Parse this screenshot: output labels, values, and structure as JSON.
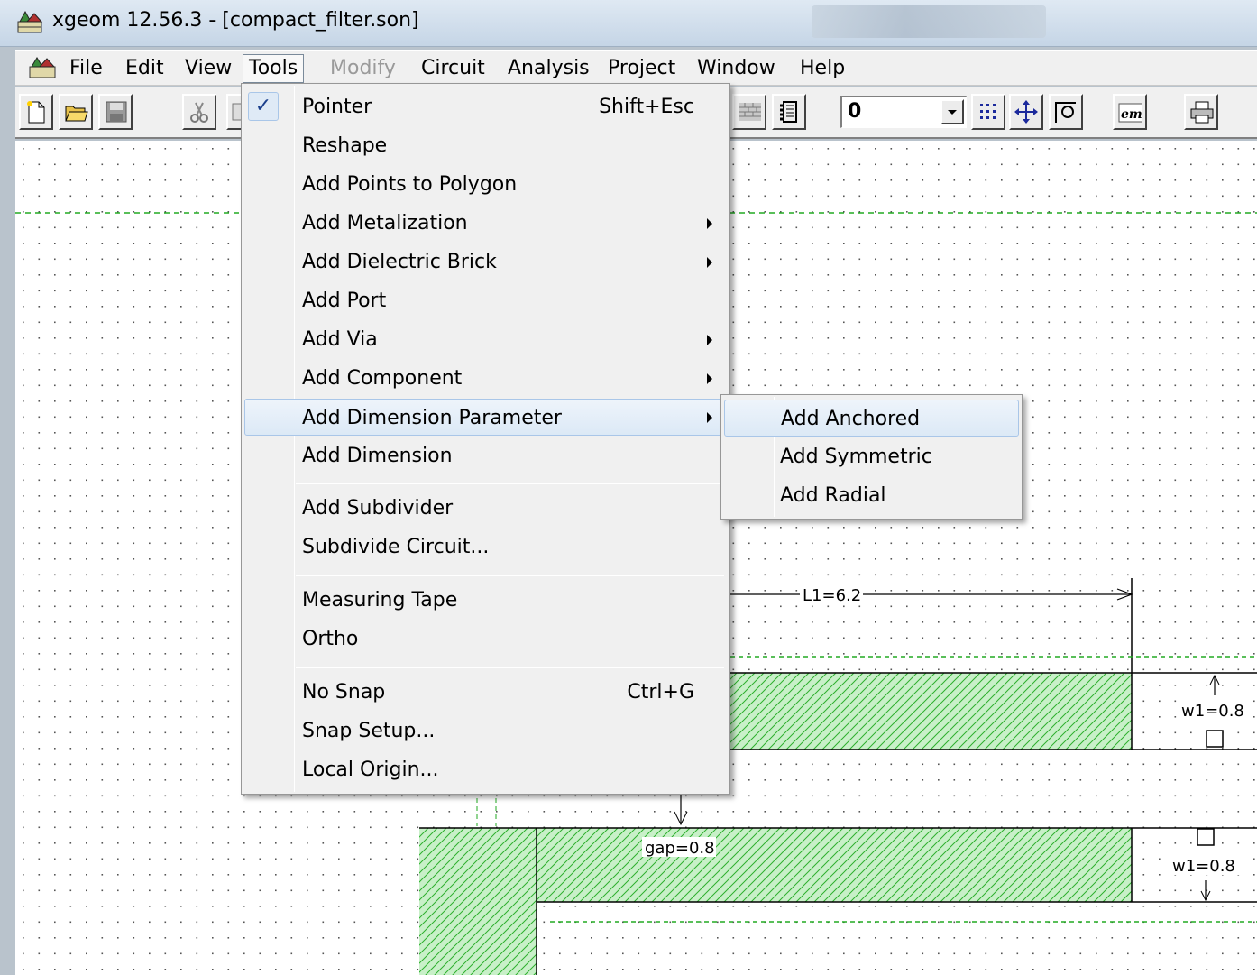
{
  "window": {
    "title": "xgeom 12.56.3 - [compact_filter.son]"
  },
  "menubar": {
    "items": [
      "File",
      "Edit",
      "View",
      "Tools",
      "Modify",
      "Circuit",
      "Analysis",
      "Project",
      "Window",
      "Help"
    ],
    "open_item": "Tools",
    "disabled_item": "Modify"
  },
  "toolbar": {
    "level_value": "0",
    "em_label": "em"
  },
  "tools_menu": {
    "items": [
      {
        "label": "Pointer",
        "shortcut": "Shift+Esc",
        "checked": true
      },
      {
        "label": "Reshape"
      },
      {
        "label": "Add Points to Polygon"
      },
      {
        "label": "Add Metalization",
        "submenu": true
      },
      {
        "label": "Add Dielectric Brick",
        "submenu": true
      },
      {
        "label": "Add Port"
      },
      {
        "label": "Add Via",
        "submenu": true
      },
      {
        "label": "Add Component",
        "submenu": true
      },
      {
        "label": "Add Dimension Parameter",
        "submenu": true,
        "highlighted": true
      },
      {
        "label": "Add Dimension"
      },
      {
        "label": "Add Subdivider"
      },
      {
        "label": "Subdivide Circuit..."
      },
      {
        "label": "Measuring Tape"
      },
      {
        "label": "Ortho"
      },
      {
        "label": "No Snap",
        "shortcut": "Ctrl+G"
      },
      {
        "label": "Snap Setup..."
      },
      {
        "label": "Local Origin..."
      }
    ]
  },
  "dimension_submenu": {
    "items": [
      "Add Anchored",
      "Add Symmetric",
      "Add Radial"
    ],
    "highlighted": "Add Anchored"
  },
  "canvas": {
    "labels": {
      "l1": "L1=6.2",
      "w1_top": "w1=0.8",
      "gap": "gap=0.8",
      "w1_bottom": "w1=0.8"
    },
    "colors": {
      "metal_fill": "#c8f0c8",
      "metal_hatch": "#2db02d",
      "box_line": "#22aa22"
    }
  }
}
